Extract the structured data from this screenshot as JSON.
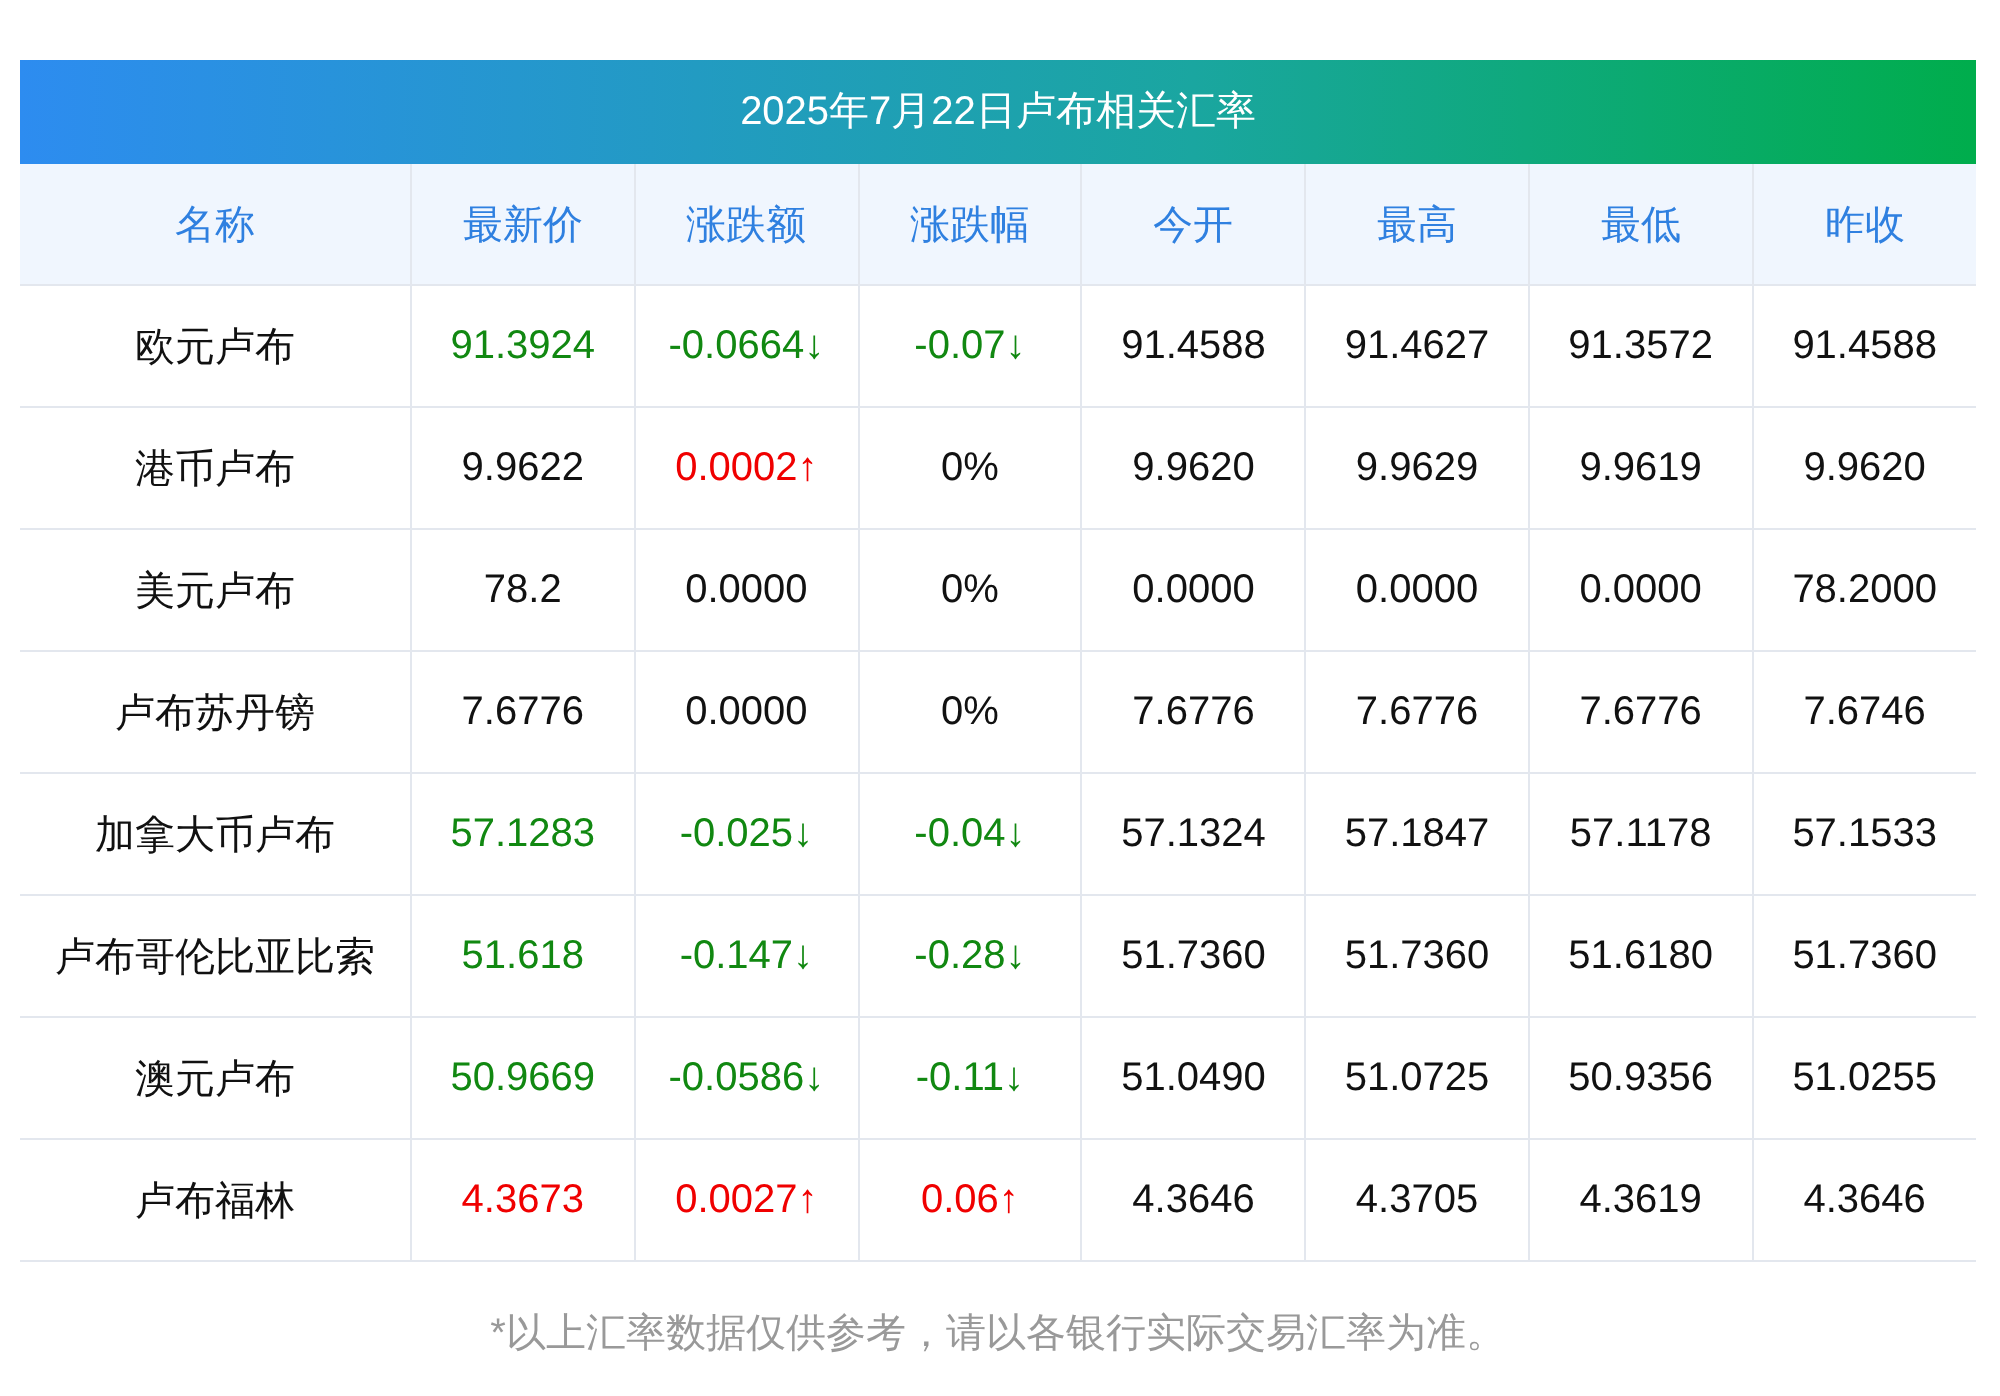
{
  "title": "2025年7月22日卢布相关汇率",
  "columns": [
    "名称",
    "最新价",
    "涨跌额",
    "涨跌幅",
    "今开",
    "最高",
    "最低",
    "昨收"
  ],
  "rows": [
    {
      "name": "欧元卢布",
      "cells": [
        {
          "text": "91.3924",
          "color": "#118811"
        },
        {
          "text": "-0.0664↓",
          "color": "#118811"
        },
        {
          "text": "-0.07↓",
          "color": "#118811"
        },
        {
          "text": "91.4588"
        },
        {
          "text": "91.4627"
        },
        {
          "text": "91.3572"
        },
        {
          "text": "91.4588"
        }
      ]
    },
    {
      "name": "港币卢布",
      "cells": [
        {
          "text": "9.9622"
        },
        {
          "text": "0.0002↑",
          "color": "#f00000"
        },
        {
          "text": "0%"
        },
        {
          "text": "9.9620"
        },
        {
          "text": "9.9629"
        },
        {
          "text": "9.9619"
        },
        {
          "text": "9.9620"
        }
      ]
    },
    {
      "name": "美元卢布",
      "cells": [
        {
          "text": "78.2"
        },
        {
          "text": "0.0000"
        },
        {
          "text": "0%"
        },
        {
          "text": "0.0000"
        },
        {
          "text": "0.0000"
        },
        {
          "text": "0.0000"
        },
        {
          "text": "78.2000"
        }
      ]
    },
    {
      "name": "卢布苏丹镑",
      "cells": [
        {
          "text": "7.6776"
        },
        {
          "text": "0.0000"
        },
        {
          "text": "0%"
        },
        {
          "text": "7.6776"
        },
        {
          "text": "7.6776"
        },
        {
          "text": "7.6776"
        },
        {
          "text": "7.6746"
        }
      ]
    },
    {
      "name": "加拿大币卢布",
      "cells": [
        {
          "text": "57.1283",
          "color": "#118811"
        },
        {
          "text": "-0.025↓",
          "color": "#118811"
        },
        {
          "text": "-0.04↓",
          "color": "#118811"
        },
        {
          "text": "57.1324"
        },
        {
          "text": "57.1847"
        },
        {
          "text": "57.1178"
        },
        {
          "text": "57.1533"
        }
      ]
    },
    {
      "name": "卢布哥伦比亚比索",
      "cells": [
        {
          "text": "51.618",
          "color": "#118811"
        },
        {
          "text": "-0.147↓",
          "color": "#118811"
        },
        {
          "text": "-0.28↓",
          "color": "#118811"
        },
        {
          "text": "51.7360"
        },
        {
          "text": "51.7360"
        },
        {
          "text": "51.6180"
        },
        {
          "text": "51.7360"
        }
      ]
    },
    {
      "name": "澳元卢布",
      "cells": [
        {
          "text": "50.9669",
          "color": "#118811"
        },
        {
          "text": "-0.0586↓",
          "color": "#118811"
        },
        {
          "text": "-0.11↓",
          "color": "#118811"
        },
        {
          "text": "51.0490"
        },
        {
          "text": "51.0725"
        },
        {
          "text": "50.9356"
        },
        {
          "text": "51.0255"
        }
      ]
    },
    {
      "name": "卢布福林",
      "cells": [
        {
          "text": "4.3673",
          "color": "#f00000"
        },
        {
          "text": "0.0027↑",
          "color": "#f00000"
        },
        {
          "text": "0.06↑",
          "color": "#f00000"
        },
        {
          "text": "4.3646"
        },
        {
          "text": "4.3705"
        },
        {
          "text": "4.3619"
        },
        {
          "text": "4.3646"
        }
      ]
    }
  ],
  "footnote": "*以上汇率数据仅供参考，请以各银行实际交易汇率为准。"
}
